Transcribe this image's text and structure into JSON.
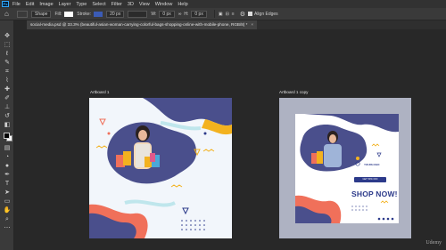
{
  "menubar": {
    "logo": "Ps",
    "items": [
      "File",
      "Edit",
      "Image",
      "Layer",
      "Type",
      "Select",
      "Filter",
      "3D",
      "View",
      "Window",
      "Help"
    ]
  },
  "options": {
    "mode": "Shape",
    "fill_label": "Fill:",
    "stroke_label": "Stroke:",
    "stroke_size": "20 px",
    "w_label": "W:",
    "w_value": "0 px",
    "h_label": "H:",
    "h_value": "0 px",
    "align_edges_label": "Align Edges",
    "fill_color": "#ffffff",
    "stroke_color": "#3b5bb5"
  },
  "document": {
    "tab_title": "social-media.psd @ 33.3% (beautiful-asian-woman-carrying-colorful-bags-shopping-online-with-mobile-phone, RGB/8) *",
    "close": "×"
  },
  "artboards": [
    {
      "label": "Artboard 1"
    },
    {
      "label": "Artboard 1 copy"
    }
  ],
  "design": {
    "headline": "SHOP NOW!",
    "brand": "YOURLOGO",
    "pill": "GET 50% OFF",
    "accent_blue": "#2c3a8a",
    "accent_coral": "#f0705a",
    "accent_yellow": "#f3b21f",
    "accent_aqua": "#bfe6ec"
  },
  "watermark": "Udemy"
}
